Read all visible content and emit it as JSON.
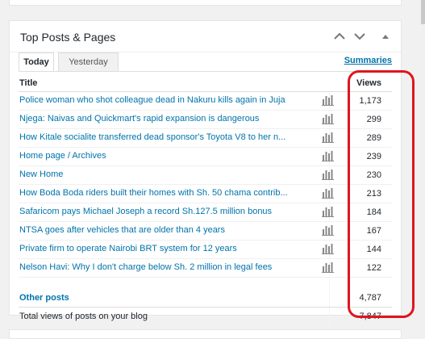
{
  "widget": {
    "title": "Top Posts & Pages",
    "controls": {
      "up": "chevron-up",
      "down": "chevron-down",
      "toggle": "triangle-up"
    }
  },
  "tabs": [
    {
      "label": "Today",
      "active": true
    },
    {
      "label": "Yesterday",
      "active": false
    }
  ],
  "summaries_label": "Summaries",
  "table": {
    "col_title": "Title",
    "col_views": "Views",
    "rows": [
      {
        "title": "Police woman who shot colleague dead in Nakuru kills again in Juja",
        "views": "1,173"
      },
      {
        "title": "Njega: Naivas and Quickmart's rapid expansion is dangerous",
        "views": "299"
      },
      {
        "title": "How Kitale socialite transferred dead sponsor's Toyota V8 to her n...",
        "views": "289"
      },
      {
        "title": "Home page / Archives",
        "views": "239"
      },
      {
        "title": "New Home",
        "views": "230"
      },
      {
        "title": "How Boda Boda riders built their homes with Sh. 50 chama contrib...",
        "views": "213"
      },
      {
        "title": "Safaricom pays Michael Joseph a record Sh.127.5 million bonus",
        "views": "184"
      },
      {
        "title": "NTSA goes after vehicles that are older than 4 years",
        "views": "167"
      },
      {
        "title": "Private firm to operate Nairobi BRT system for 12 years",
        "views": "144"
      },
      {
        "title": "Nelson Havi: Why I don't charge below Sh. 2 million in legal fees",
        "views": "122"
      }
    ],
    "other_label": "Other posts",
    "other_views": "4,787",
    "total_label": "Total views of posts on your blog",
    "total_views": "7,847"
  },
  "colors": {
    "link": "#0073aa",
    "highlight": "#e0151e",
    "text": "#23282d"
  }
}
